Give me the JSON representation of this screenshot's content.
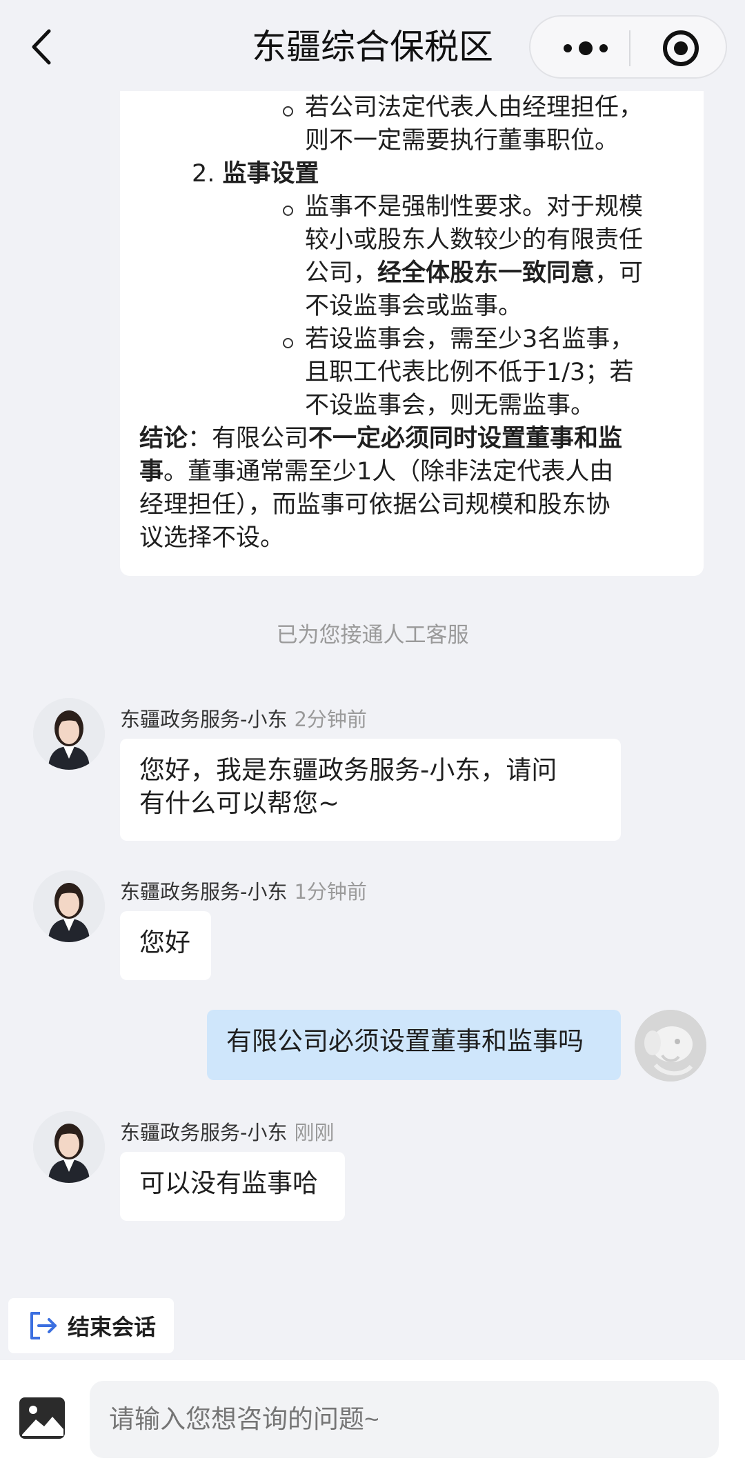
{
  "header": {
    "title": "东疆综合保税区",
    "back_icon": "chevron-left-icon",
    "more_icon": "more-dots-icon",
    "close_icon": "target-circle-icon"
  },
  "answer": {
    "line1": "若公司法定代表人由经理担任，",
    "line2": "则不一定需要执行董事职位。",
    "item2_number": "2.",
    "item2_title": "监事设置",
    "s1_l1": "监事不是强制性要求。对于规模",
    "s1_l2": "较小或股东人数较少的有限责任",
    "s1_l3_pre": "公司，",
    "s1_l3_bold": "经全体股东一致同意",
    "s1_l3_post": "，可",
    "s1_l4": "不设监事会或监事。",
    "s2_l1": "若设监事会，需至少3名监事，",
    "s2_l2": "且职工代表比例不低于1/3；若",
    "s2_l3": "不设监事会，则无需监事。",
    "conclusion_label": "结论",
    "conclusion_colon": "：有限公司",
    "conclusion_bold1": "不一定必须同时设置董事和监",
    "conclusion_bold2": "事",
    "conclusion_l2": "。董事通常需至少1人（除非法定代表人由",
    "conclusion_l3": "经理担任），而监事可依据公司规模和股东协",
    "conclusion_l4": "议选择不设。"
  },
  "system_note": "已为您接通人工客服",
  "messages": [
    {
      "sender": "东疆政务服务-小东",
      "time": "2分钟前",
      "text1": "您好，我是东疆政务服务-小东，请问",
      "text2": "有什么可以帮您~"
    },
    {
      "sender": "东疆政务服务-小东",
      "time": "1分钟前",
      "text1": "您好"
    },
    {
      "from": "user",
      "text1": "有限公司必须设置董事和监事吗"
    },
    {
      "sender": "东疆政务服务-小东",
      "time": "刚刚",
      "text1": "可以没有监事哈"
    }
  ],
  "end_session": {
    "label": "结束会话",
    "icon": "exit-icon"
  },
  "input": {
    "placeholder": "请输入您想咨询的问题~",
    "image_icon": "image-icon"
  }
}
